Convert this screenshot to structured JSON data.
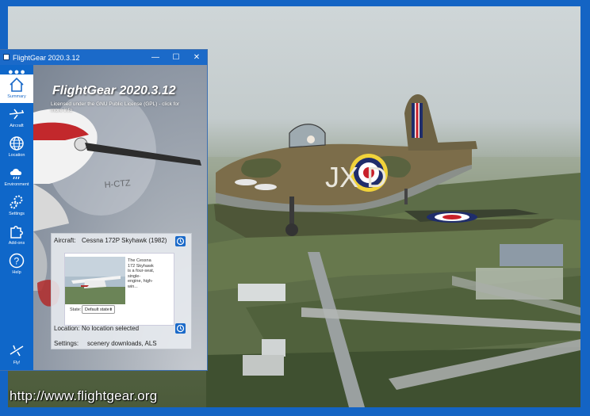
{
  "scene": {
    "url_text": "http://www.flightgear.org",
    "aircraft_markings": "JX  D",
    "sky_color": "#cfd6d8",
    "ground_color": "#5a6a48"
  },
  "window": {
    "title": "FlightGear 2020.3.12",
    "minimize_glyph": "—",
    "maximize_glyph": "☐",
    "close_glyph": "✕"
  },
  "sidebar": {
    "dots": "●●●",
    "items": [
      {
        "label": "Summary",
        "icon": "home-icon"
      },
      {
        "label": "Aircraft",
        "icon": "airplane-icon"
      },
      {
        "label": "Location",
        "icon": "globe-icon"
      },
      {
        "label": "Environment",
        "icon": "weather-icon"
      },
      {
        "label": "Settings",
        "icon": "gears-icon"
      },
      {
        "label": "Add-ons",
        "icon": "puzzle-icon"
      },
      {
        "label": "Help",
        "icon": "help-icon"
      },
      {
        "label": "Fly!",
        "icon": "fly-icon"
      }
    ]
  },
  "summary": {
    "app_title": "FlightGear 2020.3.12",
    "license": "Licensed under the GNU Public License (GPL) - click for more info",
    "aircraft_label": "Aircraft:",
    "aircraft_value": "Cessna 172P Skyhawk (1982)",
    "aircraft_desc": "The Cessna 172 Skyhawk is a four-seat, single-engine, high-win...",
    "state_label": "State:",
    "state_value": "Default state",
    "location_label": "Location:",
    "location_value": "No location selected",
    "settings_label": "Settings:",
    "settings_value": "scenery downloads, ALS"
  }
}
